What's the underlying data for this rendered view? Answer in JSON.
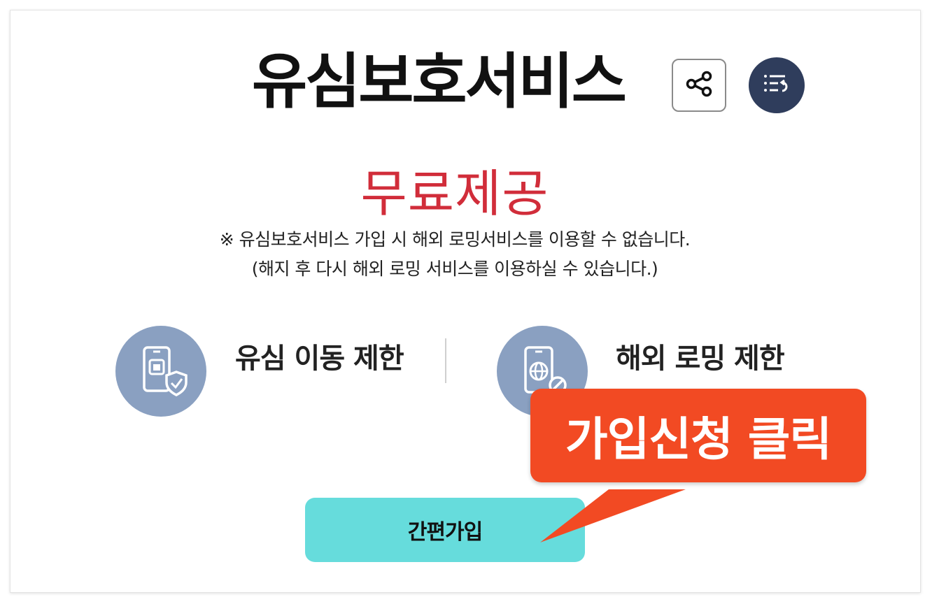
{
  "title": "유심보호서비스",
  "share_icon": "share-icon",
  "list_icon": "list-return-icon",
  "free_label": "무료제공",
  "notice": {
    "line1": "※ 유심보호서비스 가입 시 해외 로밍서비스를 이용할 수 없습니다.",
    "line2": "(해지 후 다시 해외 로밍 서비스를 이용하실 수 있습니다.)"
  },
  "features": [
    {
      "label": "유심 이동 제한",
      "icon": "phone-shield-icon"
    },
    {
      "label": "해외 로밍 제한",
      "icon": "phone-globe-block-icon"
    }
  ],
  "join_button": "간편가입",
  "callout": "가입신청 클릭",
  "colors": {
    "title": "#111111",
    "free": "#d12d3a",
    "feature_icon_bg": "#8aa0c1",
    "join_button_bg": "#66dcdc",
    "callout_bg": "#f24a23",
    "list_button_bg": "#2f3d5c"
  }
}
